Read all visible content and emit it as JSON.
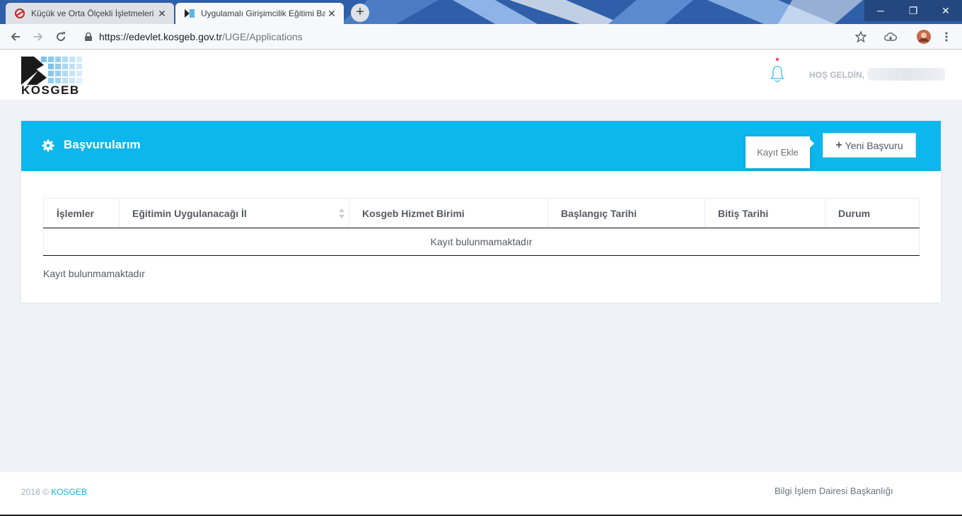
{
  "browser": {
    "tabs": [
      {
        "title": "Küçük ve Orta Ölçekli İşletmeleri",
        "active": false
      },
      {
        "title": "Uygulamalı Girişimcilik Eğitimi Ba",
        "active": true
      }
    ],
    "new_tab": "+",
    "url_main": "https://edevlet.kosgeb.gov.tr",
    "url_path": "/UGE/Applications",
    "window_buttons": [
      "─",
      "❐",
      "✕"
    ]
  },
  "header": {
    "logo_text": "KOSGEB",
    "welcome": "HOŞ GELDİN,"
  },
  "portlet": {
    "title": "Başvurularım",
    "tooltip": "Kayıt Ekle",
    "new_button_label": "Yeni Başvuru"
  },
  "table": {
    "columns": [
      "İşlemler",
      "Eğitimin Uygulanacağı İl",
      "Kosgeb Hizmet Birimi",
      "Başlangıç Tarihi",
      "Bitiş Tarihi",
      "Durum"
    ],
    "empty_message": "Kayıt bulunmamaktadır"
  },
  "info_text": "Kayıt bulunmamaktadır",
  "footer": {
    "year_copy": "2018 ©",
    "brand_link": "KOSGEB",
    "right_text": "Bilgi İşlem Dairesi Başkanlığı"
  },
  "colors": {
    "accent": "#0bb7ec",
    "page_bg": "#f1f2f7",
    "tabstrip": "#2f5fa8"
  }
}
